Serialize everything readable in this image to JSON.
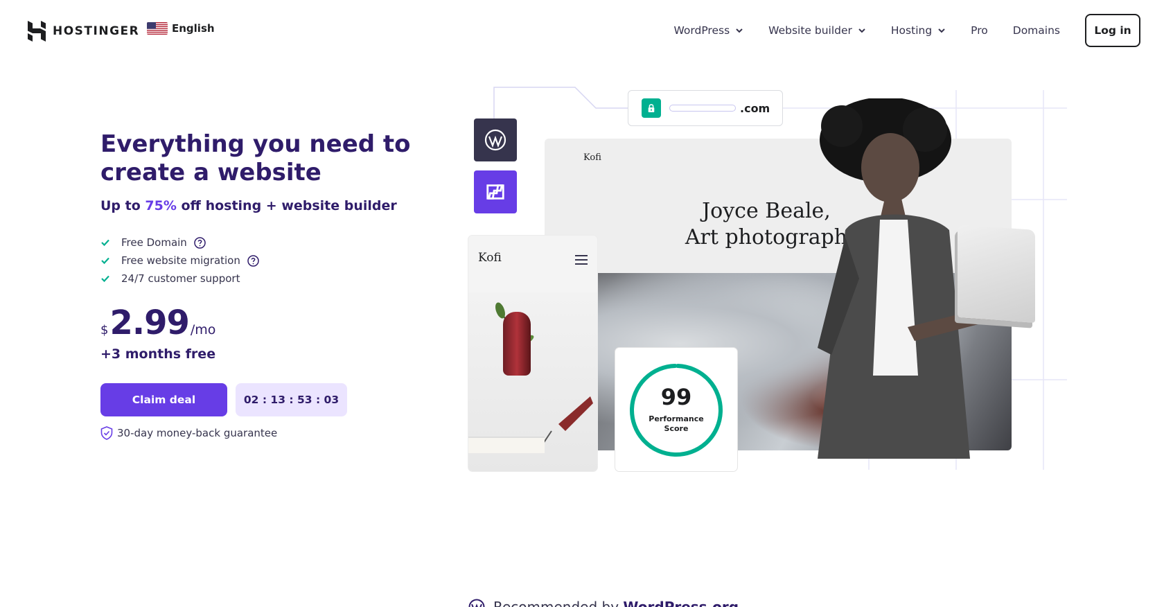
{
  "header": {
    "logo_text": "HOSTINGER",
    "language": "English",
    "nav": [
      {
        "label": "WordPress",
        "has_dropdown": true
      },
      {
        "label": "Website builder",
        "has_dropdown": true
      },
      {
        "label": "Hosting",
        "has_dropdown": true
      },
      {
        "label": "Pro",
        "has_dropdown": false
      },
      {
        "label": "Domains",
        "has_dropdown": false
      }
    ],
    "login_label": "Log in"
  },
  "hero": {
    "title": "Everything you need to create a website",
    "subtitle_prefix": "Up to ",
    "subtitle_accent": "75%",
    "subtitle_suffix": " off hosting + website builder",
    "features": [
      {
        "label": "Free Domain",
        "help": true
      },
      {
        "label": "Free website migration",
        "help": true
      },
      {
        "label": "24/7 customer support",
        "help": false
      }
    ],
    "price_currency": "$",
    "price_amount": "2.99",
    "price_period": "/mo",
    "bonus": "+3 months free",
    "cta_label": "Claim deal",
    "timer": "02 : 13 : 53 : 03",
    "guarantee": "30-day money-back guarantee"
  },
  "illustration": {
    "url_suffix": ".com",
    "site_brand": "Kofi",
    "site_heading_line1": "Joyce Beale,",
    "site_heading_line2": "Art photograph",
    "mobile_brand": "Kofi",
    "perf_score": "99",
    "perf_label_1": "Performance",
    "perf_label_2": "Score",
    "perf_fraction": 0.99
  },
  "footer": {
    "recommend_prefix": "Recommended by ",
    "recommend_brand": "WordPress.org"
  },
  "colors": {
    "primary": "#673de6",
    "heading": "#2f1c6a",
    "success": "#00b090",
    "timer_bg": "#ebe4ff"
  }
}
